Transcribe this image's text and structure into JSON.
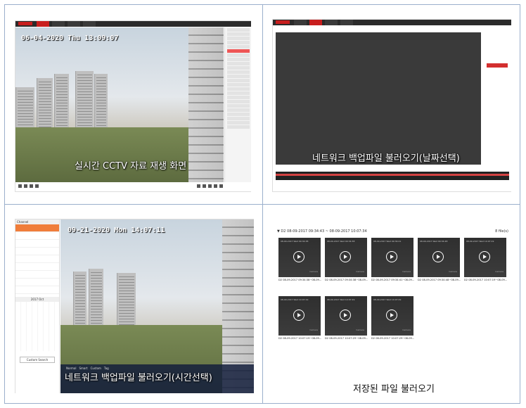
{
  "panels": {
    "live": {
      "osd_datetime": "06-04-2020 Thu 13:09:07",
      "caption": "실시간 CCTV 자료 재생 화면"
    },
    "network_date": {
      "caption": "네트워크 백업파일 불러오기(날짜선택)"
    },
    "network_time": {
      "osd_datetime": "09-21-2020 Mon 14:07:11",
      "caption": "네트워크 백업파일 불러오기(시간선택)",
      "sidebar_title": "Channel",
      "calendar_month": "2017 Oct",
      "search_button": "Custom Search",
      "mode_tabs": [
        "Normal",
        "Smart",
        "Custom",
        "Tag"
      ]
    },
    "saved_files": {
      "header": "▼ D2 08-09-2017 09:34:43 ~ 08-09-2017 10:07:34",
      "count": "8 file(s)",
      "caption": "저장된 파일 불러오기",
      "thumbnails": [
        {
          "label": "D2 08-09-2017 09:34:38~08-09..."
        },
        {
          "label": "D2 08-09-2017 09:34:38~08-09..."
        },
        {
          "label": "D2 08-09-2017 09:34:41~08-09..."
        },
        {
          "label": "D2 08-09-2017 09:34:48~08-09..."
        },
        {
          "label": "D2 08-09-2017 10:07:19~08-09..."
        },
        {
          "label": "D2 08-09-2017 10:07:19~08-09..."
        },
        {
          "label": "D2 08-09-2017 10:07:29~08-09..."
        },
        {
          "label": "D2 08-09-2017 10:07:29~08-09..."
        }
      ]
    }
  },
  "colors": {
    "border": "#9bb0cc",
    "accent_red": "#c81e1e",
    "selected_orange": "#f07d3a"
  }
}
